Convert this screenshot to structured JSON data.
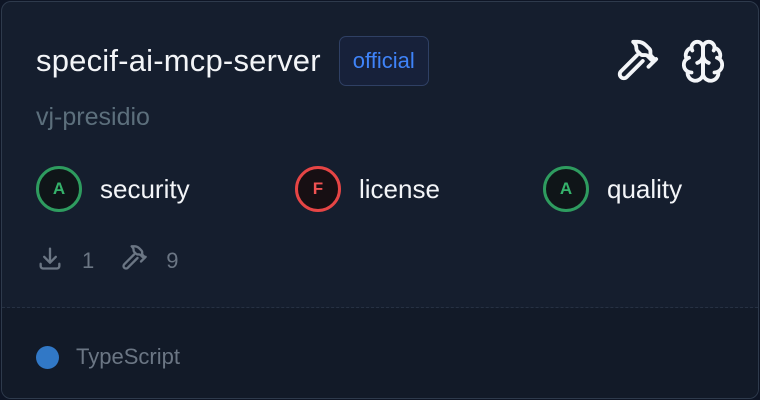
{
  "server": {
    "name": "specif-ai-mcp-server",
    "badge": "official",
    "author": "vj-presidio"
  },
  "header_icons": [
    "hammer-icon",
    "brain-icon"
  ],
  "scores": [
    {
      "grade": "A",
      "label": "security",
      "status": "good"
    },
    {
      "grade": "F",
      "label": "license",
      "status": "bad"
    },
    {
      "grade": "A",
      "label": "quality",
      "status": "good"
    }
  ],
  "stats": {
    "downloads": "1",
    "tools": "9"
  },
  "language": {
    "name": "TypeScript",
    "color": "#3178c6"
  },
  "colors": {
    "accent": "#3f83f8",
    "grade_good": "#35b26b",
    "grade_bad": "#f05252"
  }
}
